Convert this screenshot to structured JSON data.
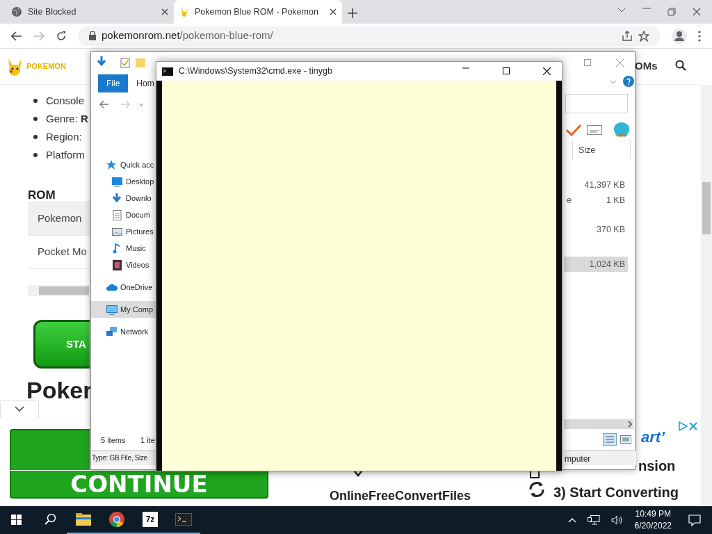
{
  "browser": {
    "tabs": [
      {
        "label": "Site Blocked",
        "selected": false
      },
      {
        "label": "Pokemon Blue ROM - Pokemon",
        "selected": true
      }
    ],
    "url_host": "pokemonrom.net",
    "url_path": "/pokemon-blue-rom/"
  },
  "webpage": {
    "logo": "POKEMON",
    "nav_item": "OMs",
    "bullets": [
      {
        "label": "Console"
      },
      {
        "label": "Genre: ",
        "value": "R"
      },
      {
        "label": "Region:"
      },
      {
        "label": "Platform"
      }
    ],
    "table": {
      "header": "ROM",
      "rows": [
        {
          "cell": "Pokemon",
          "selected": true
        },
        {
          "cell": "Pocket Mo",
          "selected": false
        }
      ]
    },
    "start_button": "STA",
    "heading": "Poker"
  },
  "ads": {
    "continue_button": "CONTINUE",
    "brand": "OnlineFreeConvertFiles",
    "steps": [
      "art’",
      "nsion",
      "3) Start Converting"
    ]
  },
  "explorer": {
    "ribbon_tabs": [
      {
        "label": "File",
        "selected": true
      },
      {
        "label": "Hom",
        "selected": false
      }
    ],
    "nav_items": [
      {
        "label": "Quick acc",
        "selected": false
      },
      {
        "label": "Desktop",
        "selected": false
      },
      {
        "label": "Downlo",
        "selected": false
      },
      {
        "label": "Docum",
        "selected": false
      },
      {
        "label": "Pictures",
        "selected": false
      },
      {
        "label": "Music",
        "selected": false
      },
      {
        "label": "Videos",
        "selected": false
      },
      {
        "label": "OneDrive",
        "selected": false
      },
      {
        "label": "My Comp",
        "selected": true
      },
      {
        "label": "Network",
        "selected": false
      }
    ],
    "column_header": "Size",
    "files": [
      {
        "size": "41,397 KB",
        "selected": false
      },
      {
        "name": "e",
        "size": "1 KB",
        "selected": false
      },
      {
        "size": "370 KB",
        "selected": false
      },
      {
        "size": "1,024 KB",
        "selected": true
      }
    ],
    "status_items": "5 items",
    "status_selected": "1 ite",
    "info": "Type: GB File, Size",
    "info_right": "mputer"
  },
  "console": {
    "title": "C:\\Windows\\System32\\cmd.exe - tinygb"
  },
  "taskbar": {
    "apps": [
      {
        "kind": "explorer"
      },
      {
        "kind": "browser"
      },
      {
        "kind": "archiver",
        "label": "7z"
      },
      {
        "kind": "terminal"
      }
    ],
    "time": "10:49 PM",
    "date": "6/20/2022"
  }
}
